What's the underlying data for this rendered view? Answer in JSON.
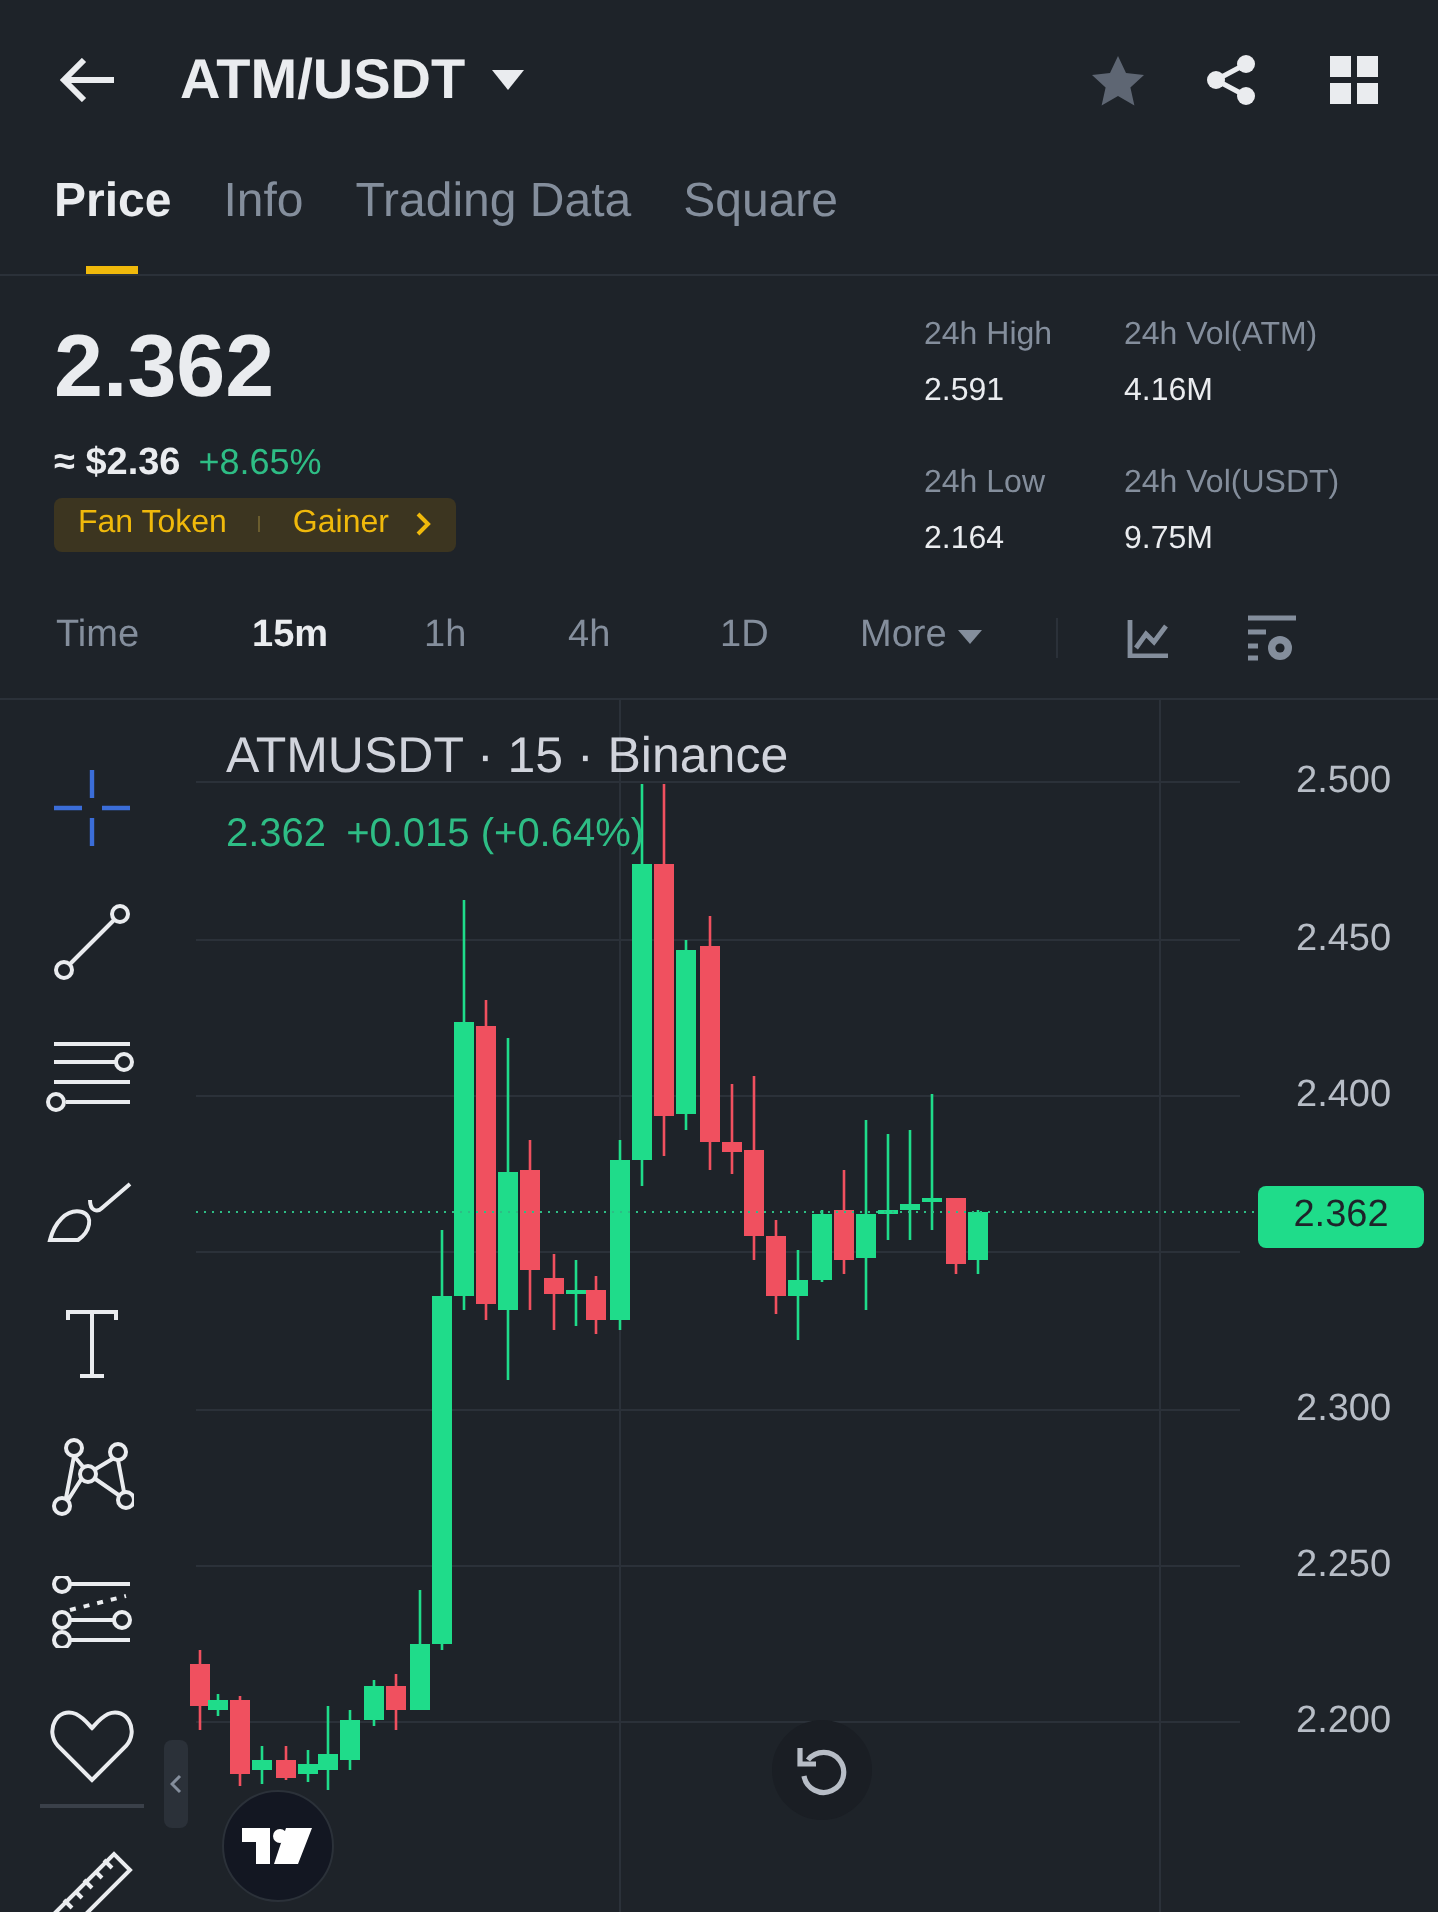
{
  "header": {
    "title": "ATM/USDT"
  },
  "tabs": [
    {
      "label": "Price",
      "selected": true
    },
    {
      "label": "Info",
      "selected": false
    },
    {
      "label": "Trading Data",
      "selected": false
    },
    {
      "label": "Square",
      "selected": false
    }
  ],
  "price": {
    "last": "2.362",
    "fiat": "≈ $2.36",
    "change": "+8.65%",
    "tags": [
      "Fan Token",
      "Gainer"
    ]
  },
  "stats": [
    {
      "label": "24h High",
      "value": "2.591"
    },
    {
      "label": "24h Vol(ATM)",
      "value": "4.16M"
    },
    {
      "label": "24h Low",
      "value": "2.164"
    },
    {
      "label": "24h Vol(USDT)",
      "value": "9.75M"
    }
  ],
  "intervals": [
    {
      "label": "Time",
      "selected": false
    },
    {
      "label": "15m",
      "selected": true
    },
    {
      "label": "1h",
      "selected": false
    },
    {
      "label": "4h",
      "selected": false
    },
    {
      "label": "1D",
      "selected": false
    },
    {
      "label": "More",
      "selected": false
    }
  ],
  "chart": {
    "title": "ATMUSDT · 15 · Binance",
    "quote": "2.362",
    "quote_change": "+0.015 (+0.64%)",
    "price_label": "2.362",
    "y_labels": [
      "2.500",
      "2.450",
      "2.400",
      "2.300",
      "2.250",
      "2.200"
    ]
  }
}
